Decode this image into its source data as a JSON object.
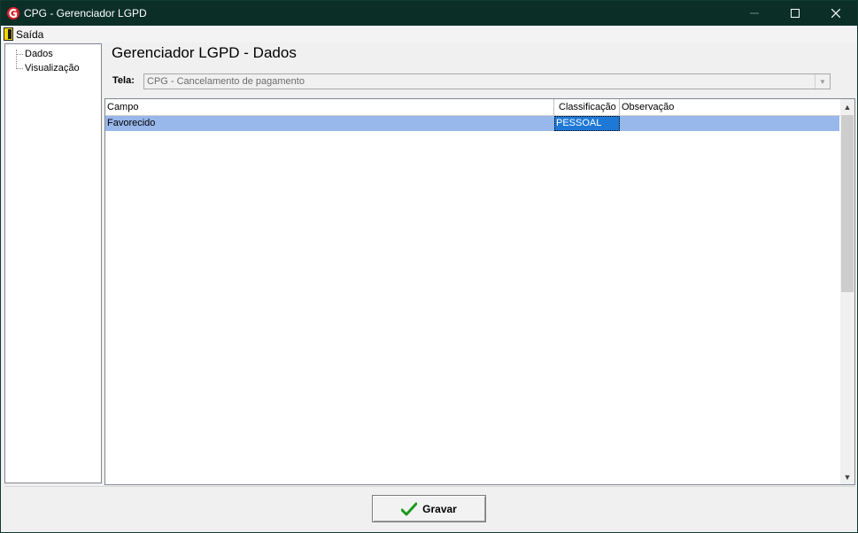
{
  "window": {
    "title": "CPG - Gerenciador LGPD"
  },
  "menu": {
    "items": [
      {
        "label": "Saída",
        "icon": "exit-door-icon"
      }
    ]
  },
  "tree": {
    "items": [
      {
        "label": "Dados"
      },
      {
        "label": "Visualização"
      }
    ]
  },
  "main": {
    "heading": "Gerenciador LGPD - Dados",
    "tela_label": "Tela:",
    "tela_value": "CPG - Cancelamento de pagamento"
  },
  "grid": {
    "columns": [
      "Campo",
      "Classificação",
      "Observação"
    ],
    "rows": [
      {
        "campo": "Favorecido",
        "classificacao": "PESSOAL",
        "observacao": ""
      }
    ]
  },
  "footer": {
    "gravar_label": "Gravar",
    "gravar_icon": "checkmark-icon"
  },
  "colors": {
    "titlebar": "#0b2f27",
    "row_highlight": "#98b7ea",
    "cell_selected": "#1e78d6",
    "check_green": "#1a9a1a"
  }
}
